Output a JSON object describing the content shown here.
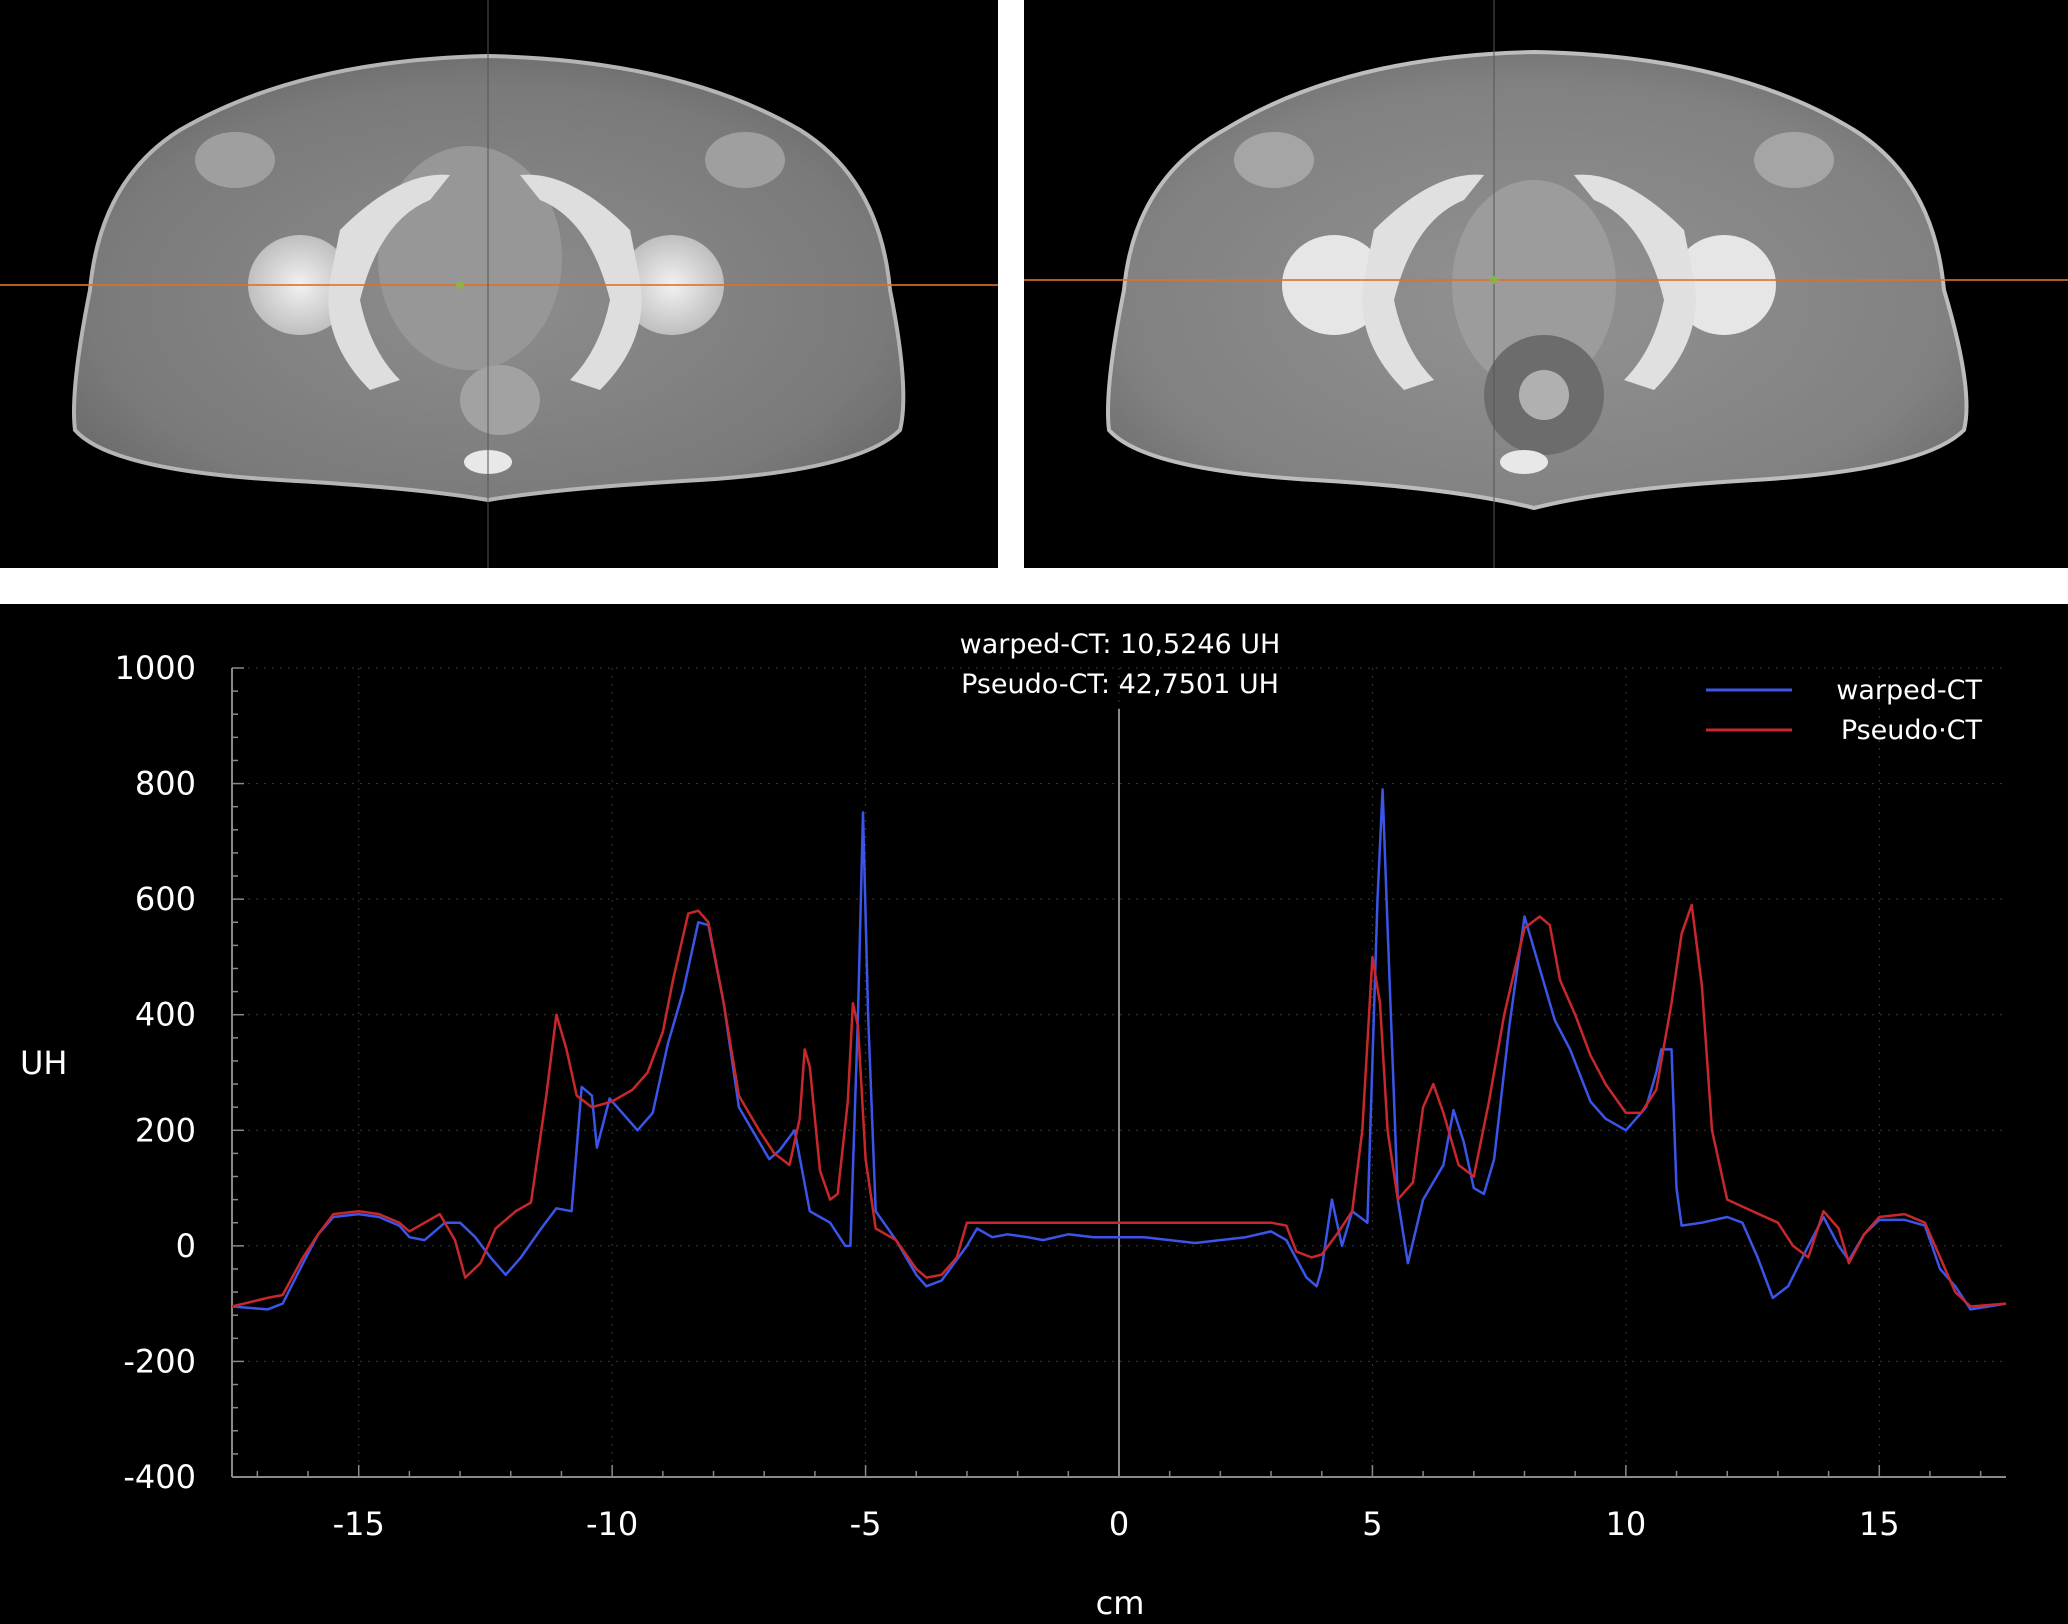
{
  "images": {
    "left": {
      "icon": "pelvis-ct-slice-warped"
    },
    "right": {
      "icon": "pelvis-ct-slice-pseudo"
    }
  },
  "colors": {
    "warped": "#3a55e8",
    "pseudo": "#c8282c",
    "axis": "#8a8a8a",
    "crosshair": "#e0702a",
    "background": "#000000"
  },
  "annotation": {
    "line1": "warped-CT: 10,5246 UH",
    "line2": "Pseudo-CT: 42,7501 UH"
  },
  "chart_data": {
    "type": "line",
    "xlabel": "cm",
    "ylabel": "UH",
    "xlim": [
      -17.5,
      17.5
    ],
    "ylim": [
      -400,
      1000
    ],
    "xticks": [
      -15,
      -10,
      -5,
      0,
      5,
      10,
      15
    ],
    "yticks": [
      -400,
      -200,
      0,
      200,
      400,
      600,
      800,
      1000
    ],
    "grid": true,
    "legend_position": "top-right",
    "series": [
      {
        "name": "warped-CT",
        "color": "#3a55e8",
        "points": [
          [
            -17.5,
            -105
          ],
          [
            -16.8,
            -110
          ],
          [
            -16.5,
            -100
          ],
          [
            -16.1,
            -30
          ],
          [
            -15.8,
            20
          ],
          [
            -15.5,
            50
          ],
          [
            -15.0,
            55
          ],
          [
            -14.6,
            50
          ],
          [
            -14.2,
            35
          ],
          [
            -14.0,
            15
          ],
          [
            -13.7,
            10
          ],
          [
            -13.3,
            40
          ],
          [
            -13.0,
            40
          ],
          [
            -12.7,
            15
          ],
          [
            -12.4,
            -20
          ],
          [
            -12.1,
            -50
          ],
          [
            -11.8,
            -20
          ],
          [
            -11.4,
            30
          ],
          [
            -11.1,
            65
          ],
          [
            -10.8,
            60
          ],
          [
            -10.6,
            275
          ],
          [
            -10.4,
            260
          ],
          [
            -10.3,
            170
          ],
          [
            -10.05,
            255
          ],
          [
            -9.8,
            230
          ],
          [
            -9.5,
            200
          ],
          [
            -9.2,
            230
          ],
          [
            -8.9,
            350
          ],
          [
            -8.6,
            440
          ],
          [
            -8.3,
            560
          ],
          [
            -8.1,
            555
          ],
          [
            -7.8,
            420
          ],
          [
            -7.5,
            240
          ],
          [
            -7.2,
            195
          ],
          [
            -6.9,
            150
          ],
          [
            -6.7,
            165
          ],
          [
            -6.4,
            200
          ],
          [
            -6.1,
            60
          ],
          [
            -5.9,
            50
          ],
          [
            -5.7,
            40
          ],
          [
            -5.4,
            0
          ],
          [
            -5.3,
            0
          ],
          [
            -5.15,
            400
          ],
          [
            -5.05,
            750
          ],
          [
            -4.95,
            400
          ],
          [
            -4.8,
            60
          ],
          [
            -4.4,
            10
          ],
          [
            -4.0,
            -50
          ],
          [
            -3.8,
            -70
          ],
          [
            -3.5,
            -60
          ],
          [
            -3.0,
            0
          ],
          [
            -2.8,
            30
          ],
          [
            -2.5,
            15
          ],
          [
            -2.2,
            20
          ],
          [
            -1.8,
            15
          ],
          [
            -1.5,
            10
          ],
          [
            -1.0,
            20
          ],
          [
            -0.5,
            15
          ],
          [
            0.0,
            15
          ],
          [
            0.5,
            15
          ],
          [
            1.0,
            10
          ],
          [
            1.5,
            5
          ],
          [
            2.0,
            10
          ],
          [
            2.5,
            15
          ],
          [
            3.0,
            25
          ],
          [
            3.3,
            10
          ],
          [
            3.7,
            -55
          ],
          [
            3.9,
            -70
          ],
          [
            4.0,
            -40
          ],
          [
            4.2,
            80
          ],
          [
            4.4,
            0
          ],
          [
            4.6,
            60
          ],
          [
            4.9,
            40
          ],
          [
            5.1,
            600
          ],
          [
            5.2,
            790
          ],
          [
            5.3,
            550
          ],
          [
            5.5,
            80
          ],
          [
            5.7,
            -30
          ],
          [
            6.0,
            80
          ],
          [
            6.4,
            140
          ],
          [
            6.6,
            235
          ],
          [
            6.8,
            180
          ],
          [
            7.0,
            100
          ],
          [
            7.2,
            90
          ],
          [
            7.4,
            150
          ],
          [
            7.7,
            380
          ],
          [
            8.0,
            570
          ],
          [
            8.3,
            480
          ],
          [
            8.6,
            390
          ],
          [
            8.9,
            340
          ],
          [
            9.3,
            250
          ],
          [
            9.6,
            220
          ],
          [
            10.0,
            200
          ],
          [
            10.4,
            240
          ],
          [
            10.6,
            300
          ],
          [
            10.7,
            340
          ],
          [
            10.9,
            340
          ],
          [
            11.0,
            100
          ],
          [
            11.1,
            35
          ],
          [
            11.5,
            40
          ],
          [
            12.0,
            50
          ],
          [
            12.3,
            40
          ],
          [
            12.6,
            -20
          ],
          [
            12.9,
            -90
          ],
          [
            13.2,
            -70
          ],
          [
            13.6,
            0
          ],
          [
            13.9,
            50
          ],
          [
            14.2,
            0
          ],
          [
            14.4,
            -25
          ],
          [
            14.7,
            20
          ],
          [
            15.0,
            45
          ],
          [
            15.5,
            45
          ],
          [
            15.9,
            35
          ],
          [
            16.2,
            -40
          ],
          [
            16.5,
            -70
          ],
          [
            16.8,
            -110
          ],
          [
            17.5,
            -100
          ]
        ]
      },
      {
        "name": "Pseudo·CT",
        "color": "#c8282c",
        "points": [
          [
            -17.5,
            -105
          ],
          [
            -16.8,
            -90
          ],
          [
            -16.5,
            -85
          ],
          [
            -16.1,
            -20
          ],
          [
            -15.8,
            20
          ],
          [
            -15.5,
            55
          ],
          [
            -15.0,
            60
          ],
          [
            -14.6,
            55
          ],
          [
            -14.2,
            40
          ],
          [
            -14.0,
            25
          ],
          [
            -13.7,
            40
          ],
          [
            -13.4,
            55
          ],
          [
            -13.1,
            10
          ],
          [
            -12.9,
            -55
          ],
          [
            -12.6,
            -30
          ],
          [
            -12.3,
            30
          ],
          [
            -11.9,
            60
          ],
          [
            -11.6,
            75
          ],
          [
            -11.3,
            260
          ],
          [
            -11.1,
            400
          ],
          [
            -10.9,
            340
          ],
          [
            -10.7,
            260
          ],
          [
            -10.4,
            240
          ],
          [
            -10.0,
            250
          ],
          [
            -9.6,
            270
          ],
          [
            -9.3,
            300
          ],
          [
            -9.0,
            370
          ],
          [
            -8.8,
            460
          ],
          [
            -8.5,
            575
          ],
          [
            -8.3,
            580
          ],
          [
            -8.1,
            560
          ],
          [
            -7.8,
            420
          ],
          [
            -7.5,
            260
          ],
          [
            -7.1,
            200
          ],
          [
            -6.8,
            160
          ],
          [
            -6.5,
            140
          ],
          [
            -6.3,
            220
          ],
          [
            -6.2,
            340
          ],
          [
            -6.1,
            310
          ],
          [
            -5.9,
            130
          ],
          [
            -5.7,
            80
          ],
          [
            -5.55,
            90
          ],
          [
            -5.35,
            250
          ],
          [
            -5.25,
            420
          ],
          [
            -5.15,
            380
          ],
          [
            -5.0,
            150
          ],
          [
            -4.8,
            30
          ],
          [
            -4.4,
            10
          ],
          [
            -4.0,
            -40
          ],
          [
            -3.8,
            -55
          ],
          [
            -3.5,
            -50
          ],
          [
            -3.2,
            -20
          ],
          [
            -3.0,
            40
          ],
          [
            -2.5,
            40
          ],
          [
            -1.0,
            40
          ],
          [
            0.0,
            40
          ],
          [
            1.0,
            40
          ],
          [
            2.0,
            40
          ],
          [
            3.0,
            40
          ],
          [
            3.3,
            35
          ],
          [
            3.5,
            -10
          ],
          [
            3.8,
            -20
          ],
          [
            4.0,
            -15
          ],
          [
            4.3,
            20
          ],
          [
            4.6,
            60
          ],
          [
            4.8,
            200
          ],
          [
            5.0,
            500
          ],
          [
            5.15,
            420
          ],
          [
            5.3,
            200
          ],
          [
            5.5,
            80
          ],
          [
            5.8,
            110
          ],
          [
            6.0,
            240
          ],
          [
            6.2,
            280
          ],
          [
            6.4,
            230
          ],
          [
            6.7,
            140
          ],
          [
            7.0,
            120
          ],
          [
            7.3,
            250
          ],
          [
            7.6,
            400
          ],
          [
            8.0,
            550
          ],
          [
            8.3,
            570
          ],
          [
            8.5,
            555
          ],
          [
            8.7,
            460
          ],
          [
            9.0,
            400
          ],
          [
            9.3,
            330
          ],
          [
            9.6,
            280
          ],
          [
            10.0,
            230
          ],
          [
            10.3,
            230
          ],
          [
            10.6,
            270
          ],
          [
            10.9,
            420
          ],
          [
            11.1,
            540
          ],
          [
            11.3,
            590
          ],
          [
            11.5,
            450
          ],
          [
            11.7,
            200
          ],
          [
            12.0,
            80
          ],
          [
            12.5,
            60
          ],
          [
            13.0,
            40
          ],
          [
            13.3,
            0
          ],
          [
            13.6,
            -20
          ],
          [
            13.9,
            60
          ],
          [
            14.2,
            30
          ],
          [
            14.4,
            -30
          ],
          [
            14.7,
            20
          ],
          [
            15.0,
            50
          ],
          [
            15.5,
            55
          ],
          [
            15.9,
            40
          ],
          [
            16.2,
            -20
          ],
          [
            16.5,
            -80
          ],
          [
            16.8,
            -105
          ],
          [
            17.5,
            -100
          ]
        ]
      }
    ]
  }
}
